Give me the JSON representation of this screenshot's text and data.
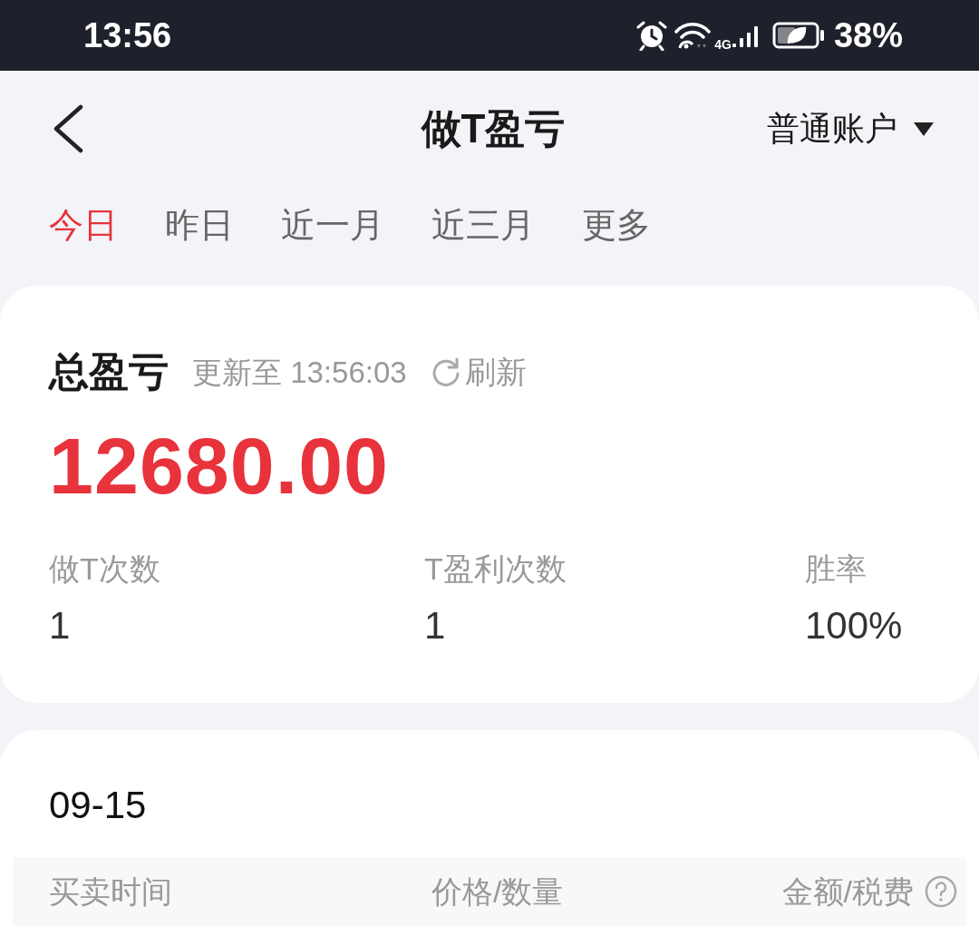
{
  "status_bar": {
    "time": "13:56",
    "network": "4G",
    "battery": "38%"
  },
  "header": {
    "title": "做T盈亏",
    "account": "普通账户"
  },
  "tabs": [
    {
      "label": "今日",
      "selected": true
    },
    {
      "label": "昨日",
      "selected": false
    },
    {
      "label": "近一月",
      "selected": false
    },
    {
      "label": "近三月",
      "selected": false
    },
    {
      "label": "更多",
      "selected": false
    }
  ],
  "summary": {
    "title": "总盈亏",
    "updated": "更新至 13:56:03",
    "refresh": "刷新",
    "total": "12680.00",
    "stats": [
      {
        "label": "做T次数",
        "value": "1"
      },
      {
        "label": "T盈利次数",
        "value": "1"
      },
      {
        "label": "胜率",
        "value": "100%"
      }
    ]
  },
  "records": {
    "date": "09-15",
    "columns": [
      "买卖时间",
      "价格/数量",
      "金额/税费"
    ]
  }
}
